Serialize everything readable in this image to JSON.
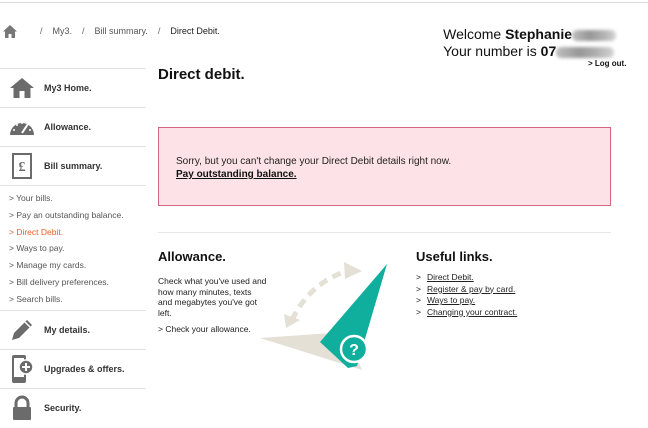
{
  "breadcrumb": {
    "items": [
      "My3.",
      "Bill summary."
    ],
    "current": "Direct Debit.",
    "separator": "/"
  },
  "welcome": {
    "prefix": "Welcome",
    "name": "Stephanie",
    "number_prefix": "Your number is",
    "number_visible": "07"
  },
  "logout": "> Log out.",
  "sidebar": {
    "items": [
      {
        "label": "My3 Home.",
        "icon": "home-icon"
      },
      {
        "label": "Allowance.",
        "icon": "gauge-icon"
      },
      {
        "label": "Bill summary.",
        "icon": "bill-icon"
      }
    ],
    "subitems": [
      "> Your bills.",
      "> Pay an outstanding balance.",
      "> Direct Debit.",
      "> Ways to pay.",
      "> Manage my cards.",
      "> Bill delivery preferences.",
      "> Search bills."
    ],
    "active_subitem": "> Direct Debit.",
    "items_after": [
      {
        "label": "My details.",
        "icon": "pencil-icon"
      },
      {
        "label": "Upgrades & offers.",
        "icon": "phone-plus-icon"
      },
      {
        "label": "Security.",
        "icon": "lock-icon"
      }
    ]
  },
  "main": {
    "title": "Direct debit.",
    "alert": {
      "message": "Sorry, but you can't change your Direct Debit details right now.",
      "link": "Pay outstanding balance."
    },
    "allowance": {
      "title": "Allowance.",
      "text": "Check what you've used and how many minutes, texts and megabytes you've got left.",
      "link": "> Check your allowance."
    },
    "useful": {
      "title": "Useful links.",
      "bullet": ">",
      "links": [
        "Direct Debit.",
        "Register & pay by card.",
        "Ways to pay.",
        "Changing your contract."
      ]
    }
  },
  "colors": {
    "accent_orange": "#e0612a",
    "alert_bg": "#fde3e7",
    "alert_border": "#d2677f",
    "teal": "#0fae9d",
    "beige": "#e4e0d5"
  }
}
